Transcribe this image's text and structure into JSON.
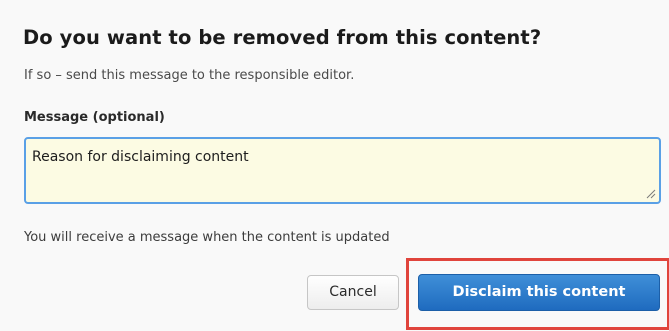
{
  "dialog": {
    "title": "Do you want to be removed from this content?",
    "subtitle": "If so – send this message to the responsible editor.",
    "message_label": "Message (optional)",
    "message_value": "Reason for disclaiming content",
    "info_text": "You will receive a message when the content is updated",
    "cancel_label": "Cancel",
    "disclaim_label": "Disclaim this content"
  },
  "colors": {
    "primary_button": "#2a7dcc",
    "textarea_background": "#fcfbe3",
    "textarea_focus_border": "#5aa0e6",
    "highlight_outline": "#e0443c"
  },
  "icons": {
    "resize_grip": "resize-grip-icon"
  }
}
